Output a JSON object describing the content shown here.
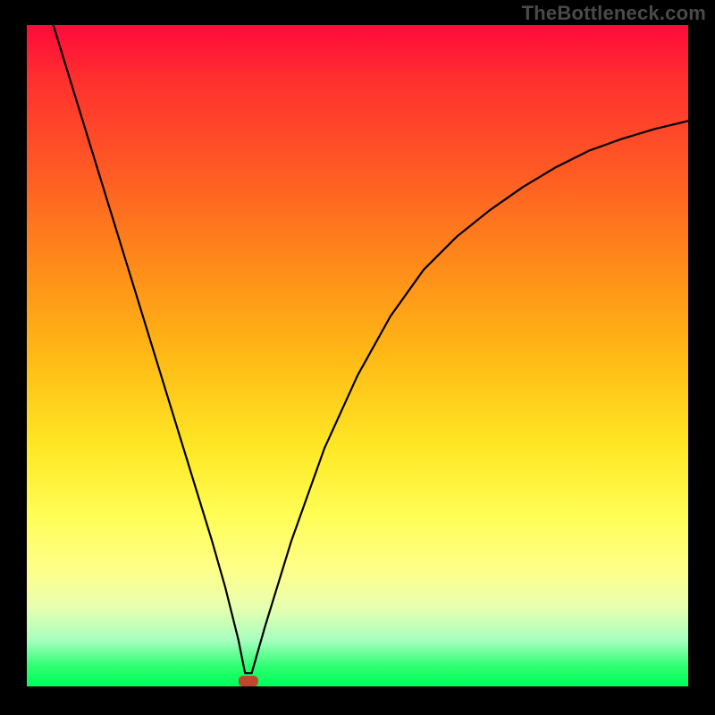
{
  "watermark": "TheBottleneck.com",
  "chart_data": {
    "type": "line",
    "title": "",
    "xlabel": "",
    "ylabel": "",
    "xlim": [
      0,
      100
    ],
    "ylim": [
      0,
      100
    ],
    "grid": false,
    "legend": false,
    "background_gradient": [
      "#ff0a3a",
      "#ffe826",
      "#00ff5a"
    ],
    "series": [
      {
        "name": "curve",
        "x": [
          4,
          8,
          12,
          16,
          20,
          24,
          28,
          30,
          32,
          33,
          34,
          36,
          40,
          45,
          50,
          55,
          60,
          65,
          70,
          75,
          80,
          85,
          90,
          95,
          100
        ],
        "y": [
          100,
          87,
          74,
          61,
          48,
          35,
          22,
          15,
          7,
          2,
          2,
          9,
          22,
          36,
          47,
          56,
          63,
          68,
          72,
          75.5,
          78.5,
          81,
          82.8,
          84.3,
          85.5
        ]
      }
    ],
    "marker": {
      "x": 33.5,
      "y": 0.8,
      "shape": "rounded-rect",
      "color": "#c0462e"
    }
  }
}
